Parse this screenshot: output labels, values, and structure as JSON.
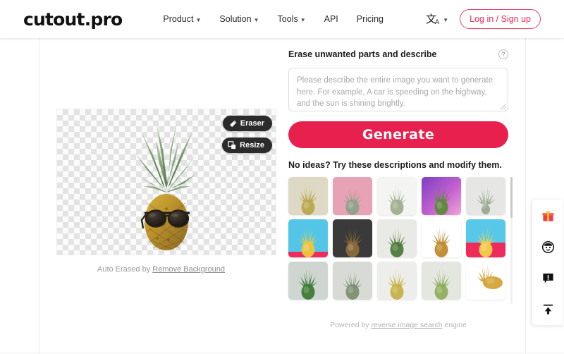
{
  "header": {
    "logo": "cutout.pro",
    "nav": [
      {
        "label": "Product",
        "has_dropdown": true
      },
      {
        "label": "Solution",
        "has_dropdown": true
      },
      {
        "label": "Tools",
        "has_dropdown": true
      },
      {
        "label": "API",
        "has_dropdown": false
      },
      {
        "label": "Pricing",
        "has_dropdown": false
      }
    ],
    "language_icon": "translate-icon",
    "language_chevron": "⌄",
    "login_label": "Log in / Sign up",
    "accent_color": "#ef2b5c"
  },
  "editor": {
    "tools": [
      {
        "label": "Eraser",
        "icon": "eraser-icon"
      },
      {
        "label": "Resize",
        "icon": "resize-icon"
      }
    ],
    "caption_prefix": "Auto Erased by",
    "caption_link": "Remove Background",
    "image_subject": "pineapple-with-sunglasses",
    "background": "transparent-checkerboard"
  },
  "describe": {
    "heading": "Erase unwanted parts and describe",
    "help_icon": "question-mark-icon",
    "help_glyph": "?",
    "textarea_value": "",
    "textarea_placeholder": "Please describe the entire image you want to generate here. For example, A car is speeding on the highway, and the sun is shining brightly.",
    "generate_label": "Generate",
    "generate_color": "#e8204e"
  },
  "ideas": {
    "heading": "No ideas? Try these descriptions and modify them.",
    "thumbnails": [
      {
        "id": 1,
        "bg": "#ded9c4",
        "accent": "#b9a84f",
        "style": "cream-backdrop-upright"
      },
      {
        "id": 2,
        "bg": "#e8a2b6",
        "accent": "#8fa18a",
        "style": "pink-backdrop-silver-crown"
      },
      {
        "id": 3,
        "bg": "#f4f4f2",
        "accent": "#9fae8e",
        "style": "white-minimal-small-crown"
      },
      {
        "id": 4,
        "bg": "#a855c9",
        "accent": "#5d8a3a",
        "style": "purple-pink-gradient-full"
      },
      {
        "id": 5,
        "bg": "#e6e6e4",
        "accent": "#9aa88e",
        "style": "grey-backdrop-crown-only"
      },
      {
        "id": 6,
        "bg": "#53c6e8",
        "accent": "#efc53c",
        "style": "cyan-backdrop-sliced"
      },
      {
        "id": 7,
        "bg": "#3a3a3a",
        "accent": "#8a6a3a",
        "style": "dark-backdrop-silhouette"
      },
      {
        "id": 8,
        "bg": "#e9e9e5",
        "accent": "#4e7a3c",
        "style": "light-grey-green-crown"
      },
      {
        "id": 9,
        "bg": "#ffffff",
        "accent": "#c08a2e",
        "style": "white-backdrop-whole-fruit"
      },
      {
        "id": 10,
        "bg": "#58c8e8",
        "accent": "#f2d04a",
        "style": "cyan-pink-split-stacked"
      },
      {
        "id": 11,
        "bg": "#cfd6d2",
        "accent": "#3f7a36",
        "style": "grey-green-dense-top"
      },
      {
        "id": 12,
        "bg": "#d8dad6",
        "accent": "#7d9070",
        "style": "grey-pale-crown"
      },
      {
        "id": 13,
        "bg": "#ededeb",
        "accent": "#c5b347",
        "style": "white-center-upright"
      },
      {
        "id": 14,
        "bg": "#e4e6e0",
        "accent": "#8fae5c",
        "style": "beige-small-pineapple"
      },
      {
        "id": 15,
        "bg": "#ffffff",
        "accent": "#d4a338",
        "style": "white-lying-sideways"
      }
    ],
    "scrollbar": "vertical-scrollbar"
  },
  "footer": {
    "prefix": "Powered by",
    "link": "reverse image search",
    "suffix": "engine"
  },
  "float_sidebar": [
    {
      "name": "gift-icon",
      "label": "gift"
    },
    {
      "name": "avatar-icon",
      "label": "account"
    },
    {
      "name": "feedback-icon",
      "label": "feedback"
    },
    {
      "name": "upload-icon",
      "label": "upload"
    }
  ]
}
